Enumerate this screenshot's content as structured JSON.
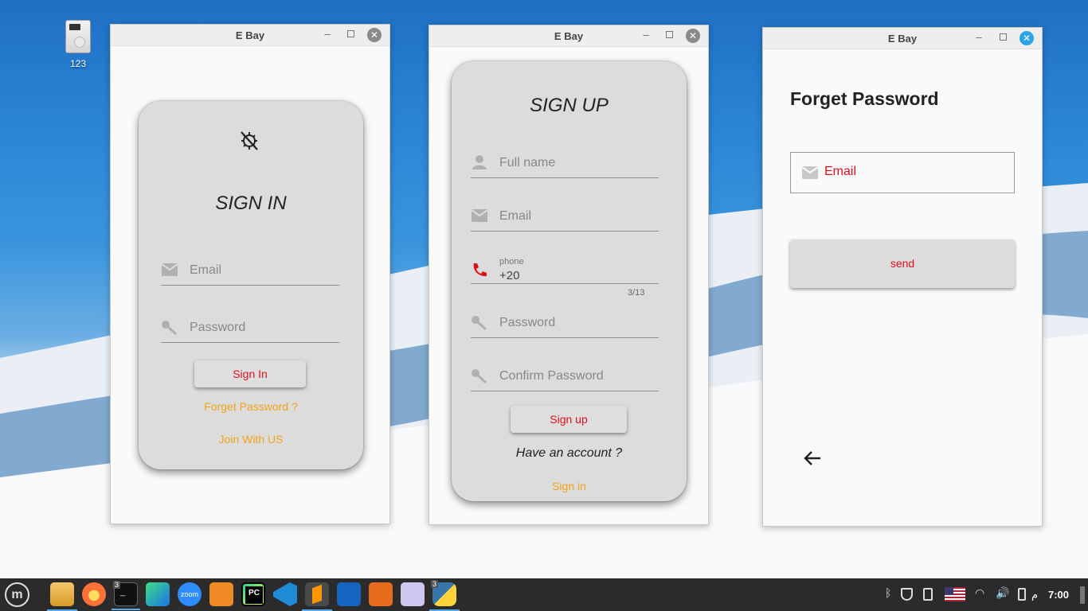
{
  "desktop": {
    "icon_label": "123"
  },
  "window1": {
    "title": "E Bay",
    "heading": "SIGN IN",
    "email_placeholder": "Email",
    "password_placeholder": "Password",
    "signin_button": "Sign In",
    "forget_link": "Forget Password ?",
    "join_link": "Join With US"
  },
  "window2": {
    "title": "E Bay",
    "heading": "SIGN UP",
    "fullname_placeholder": "Full name",
    "email_placeholder": "Email",
    "phone_label": "phone",
    "phone_value": "+20",
    "phone_counter": "3/13",
    "password_placeholder": "Password",
    "confirm_placeholder": "Confirm Password",
    "signup_button": "Sign up",
    "have_account": "Have an account ?",
    "signin_link": "Sign in"
  },
  "window3": {
    "title": "E Bay",
    "heading": "Forget Password",
    "email_placeholder": "Email",
    "send_button": "send"
  },
  "taskbar": {
    "terminal_badge": "3",
    "python_badge": "3",
    "zoom_label": "zoom",
    "clock": "7:00",
    "clock_suffix": "م"
  },
  "colors": {
    "accent_red": "#d9111b",
    "link_orange": "#f0a418",
    "card_grey": "#dcdcdc"
  }
}
